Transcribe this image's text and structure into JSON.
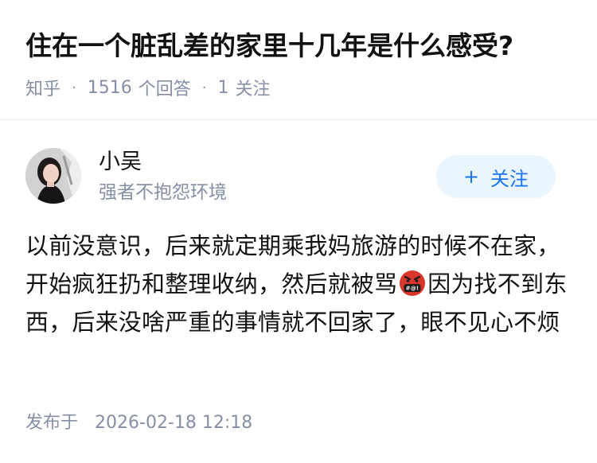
{
  "question": {
    "title": "住在一个脏乱差的家里十几年是什么感受?",
    "source": "知乎",
    "answer_count": "1516",
    "answer_label": "个回答",
    "follow_count": "1",
    "follow_label": "关注"
  },
  "author": {
    "name": "小吴",
    "bio": "强者不抱怨环境",
    "follow_button": "关注"
  },
  "answer": {
    "text_before_emoji": "以前没意识，后来就定期乘我妈旅游的时候不在家，开始疯狂扔和整理收纳，然后就被骂",
    "emoji": "angry-face-with-symbols-emoji",
    "text_after_emoji": "因为找不到东西，后来没啥严重的事情就不回家了，眼不见心不烦"
  },
  "publish": {
    "label": "发布于",
    "datetime": "2026-02-18 12:18"
  },
  "colors": {
    "title": "#121212",
    "meta": "#8590a6",
    "follow_bg": "#ebf5fd",
    "follow_text": "#1772f6",
    "emoji_red": "#d9362b"
  }
}
